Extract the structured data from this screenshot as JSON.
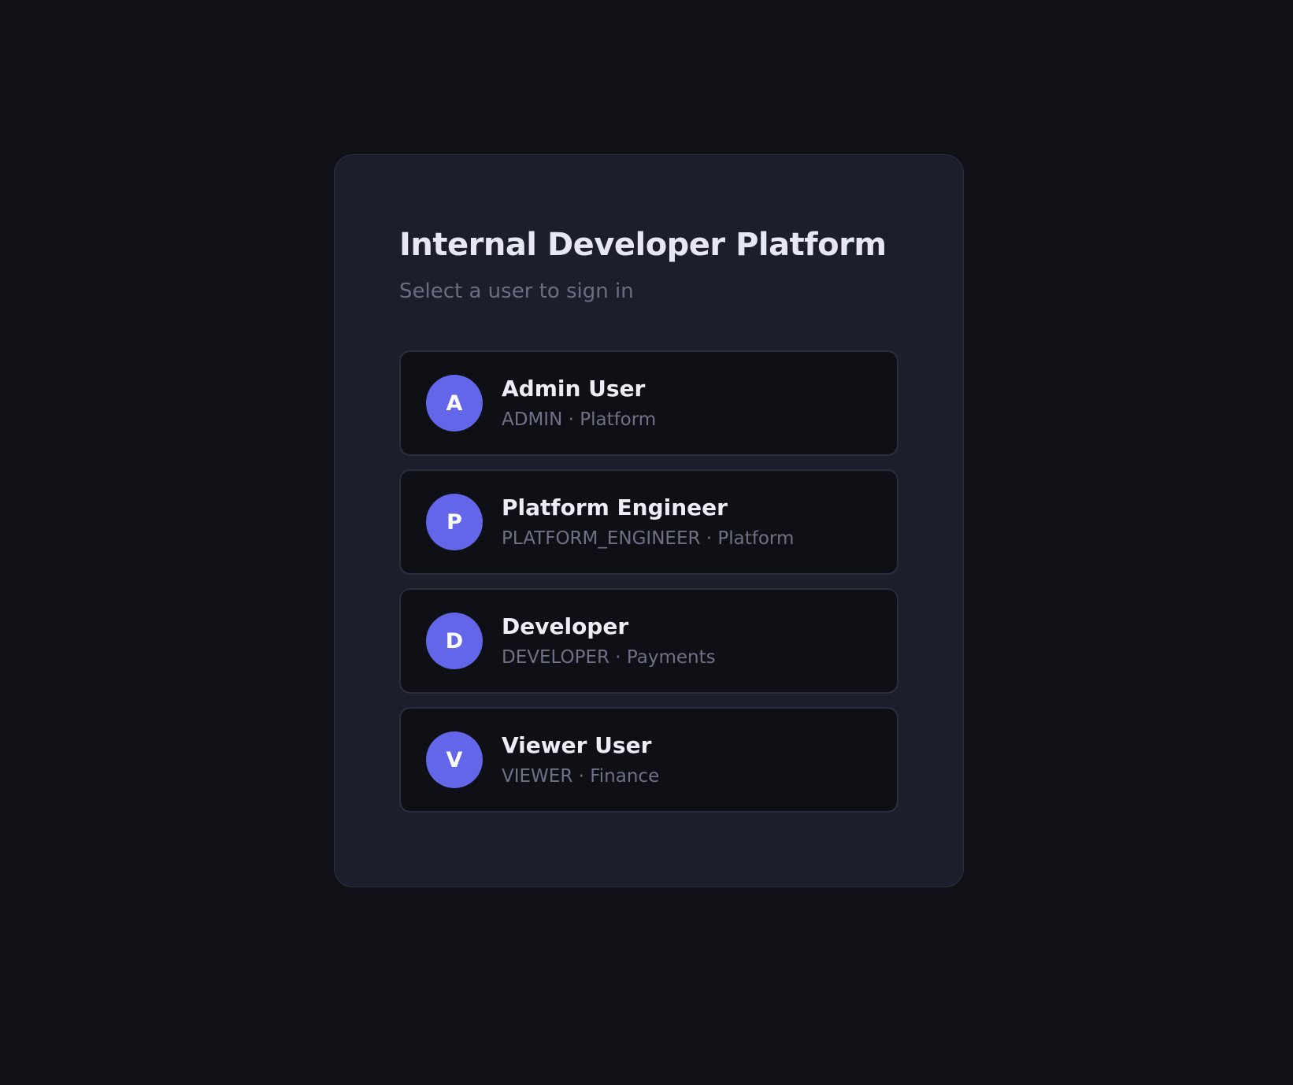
{
  "login": {
    "title": "Internal Developer Platform",
    "subtitle": "Select a user to sign in",
    "users": [
      {
        "initial": "A",
        "name": "Admin User",
        "role": "ADMIN",
        "team": "Platform",
        "meta": "ADMIN · Platform"
      },
      {
        "initial": "P",
        "name": "Platform Engineer",
        "role": "PLATFORM_ENGINEER",
        "team": "Platform",
        "meta": "PLATFORM_ENGINEER · Platform"
      },
      {
        "initial": "D",
        "name": "Developer",
        "role": "DEVELOPER",
        "team": "Payments",
        "meta": "DEVELOPER · Payments"
      },
      {
        "initial": "V",
        "name": "Viewer User",
        "role": "VIEWER",
        "team": "Finance",
        "meta": "VIEWER · Finance"
      }
    ]
  },
  "colors": {
    "background": "#0f1117",
    "card": "#1c1e2b",
    "item": "#0f1016",
    "avatar": "#6366e8",
    "title": "#e6e7f2",
    "muted": "#6b6e82"
  }
}
